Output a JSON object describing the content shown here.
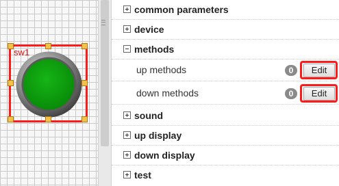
{
  "canvas": {
    "component_label": "sw1"
  },
  "panel": {
    "sections": [
      {
        "label": "common parameters",
        "expanded": false
      },
      {
        "label": "device",
        "expanded": false
      },
      {
        "label": "methods",
        "expanded": true
      },
      {
        "label": "sound",
        "expanded": false
      },
      {
        "label": "up display",
        "expanded": false
      },
      {
        "label": "down display",
        "expanded": false
      },
      {
        "label": "test",
        "expanded": false
      }
    ],
    "methods": [
      {
        "label": "up methods",
        "count": "0",
        "button_label": "Edit"
      },
      {
        "label": "down methods",
        "count": "0",
        "button_label": "Edit"
      }
    ]
  },
  "colors": {
    "highlight": "#ff1a1a",
    "knob_green": "#0a9a0a",
    "badge": "#8a8a8a"
  },
  "icons": {
    "collapsed": "plus-box-icon",
    "expanded": "minus-box-icon"
  }
}
